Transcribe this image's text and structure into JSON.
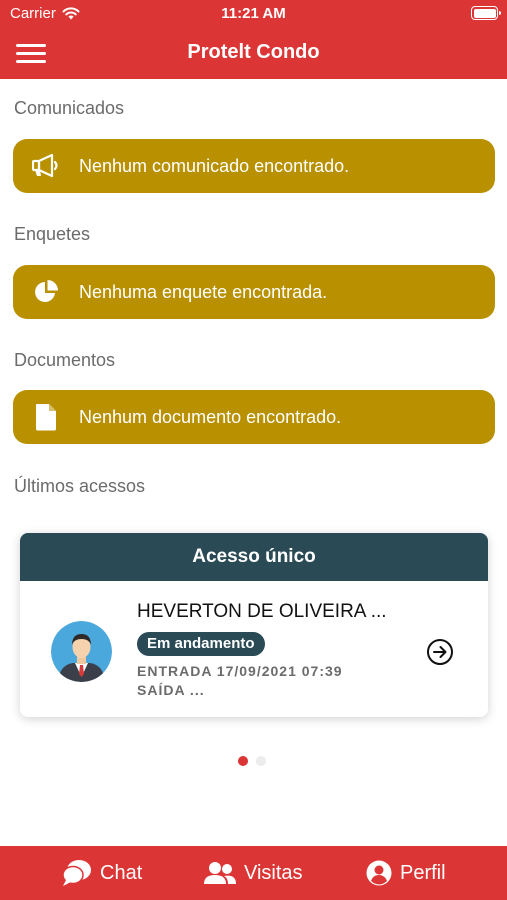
{
  "status_bar": {
    "carrier": "Carrier",
    "time": "11:21 AM"
  },
  "header": {
    "title": "Protelt Condo",
    "menu_icon": "hamburger-menu-icon"
  },
  "sections": [
    {
      "title": "Comunicados",
      "empty_message": "Nenhum comunicado encontrado.",
      "icon": "megaphone-icon"
    },
    {
      "title": "Enquetes",
      "empty_message": "Nenhuma enquete encontrada.",
      "icon": "pie-chart-icon"
    },
    {
      "title": "Documentos",
      "empty_message": "Nenhum documento encontrado.",
      "icon": "document-icon"
    }
  ],
  "last_access": {
    "title": "Últimos acessos",
    "card": {
      "header": "Acesso único",
      "name": "HEVERTON DE OLIVEIRA ...",
      "status": "Em andamento",
      "entry": "ENTRADA 17/09/2021 07:39",
      "exit": "SAÍDA ..."
    }
  },
  "pagination": {
    "pages": 2,
    "current": 1
  },
  "tabs": [
    {
      "label": "Chat",
      "icon": "chat-bubbles-icon"
    },
    {
      "label": "Visitas",
      "icon": "people-icon"
    },
    {
      "label": "Perfil",
      "icon": "user-circle-icon"
    }
  ],
  "colors": {
    "primary": "#dc3535",
    "card_gold": "#b89000",
    "teal": "#2a4a56"
  }
}
